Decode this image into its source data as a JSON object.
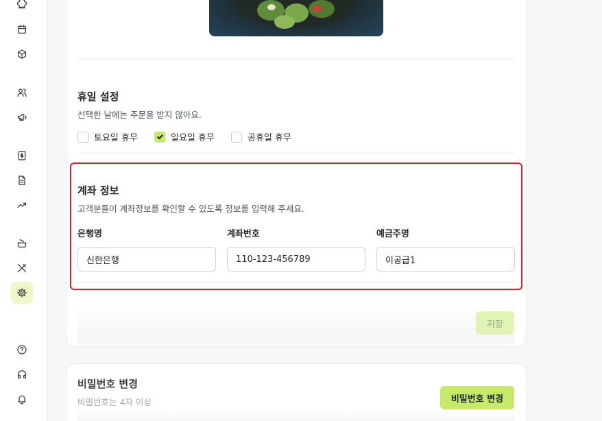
{
  "sidebar": {
    "icons": [
      {
        "name": "chef-hat-icon",
        "active": false
      },
      {
        "name": "calendar-icon",
        "active": false
      },
      {
        "name": "box-icon",
        "active": false
      },
      {
        "name": "users-icon",
        "active": false
      },
      {
        "name": "megaphone-icon",
        "active": false
      },
      {
        "name": "dollar-icon",
        "active": false
      },
      {
        "name": "document-icon",
        "active": false
      },
      {
        "name": "trend-up-icon",
        "active": false
      },
      {
        "name": "cooking-pot-icon",
        "active": false
      },
      {
        "name": "utensils-crossed-icon",
        "active": false
      },
      {
        "name": "settings-icon",
        "active": true
      },
      {
        "name": "help-icon",
        "active": false
      },
      {
        "name": "headphones-icon",
        "active": false
      },
      {
        "name": "bell-icon",
        "active": false
      }
    ]
  },
  "holiday": {
    "title": "휴일 설정",
    "description": "선택한 날에는 주문을 받지 않아요.",
    "options": [
      {
        "label": "토요일 휴무",
        "checked": false
      },
      {
        "label": "일요일 휴무",
        "checked": true
      },
      {
        "label": "공휴일 휴무",
        "checked": false
      }
    ]
  },
  "account": {
    "title": "계좌 정보",
    "description": "고객분들이 계좌정보를 확인할 수 있도록 정보를 입력해 주세요.",
    "fields": [
      {
        "label": "은행명",
        "value": "신한은행"
      },
      {
        "label": "계좌번호",
        "value": "110-123-456789"
      },
      {
        "label": "예금주명",
        "value": "이공급1"
      }
    ]
  },
  "save_label": "저장",
  "password": {
    "title": "비밀번호 변경",
    "description": "비밀번호는 4자 이상",
    "button_label": "비밀번호 변경"
  },
  "colors": {
    "accent": "#c6ea6a",
    "accent_light": "#e2f3b6",
    "highlight": "#d4202a"
  }
}
